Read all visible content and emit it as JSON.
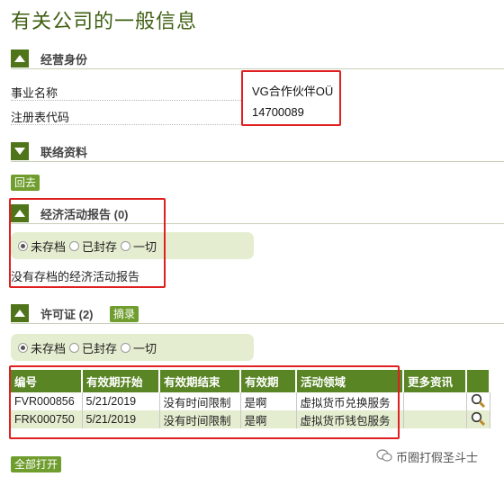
{
  "page_title": "有关公司的一般信息",
  "sections": {
    "business": {
      "title": "经营身份"
    },
    "contact": {
      "title": "联络资料"
    },
    "reports": {
      "title": "经济活动报告 (0)",
      "empty_note": "没有存档的经济活动报告"
    },
    "licenses": {
      "title": "许可证 (2)",
      "summary_button": "摘录"
    }
  },
  "fields": {
    "name_label": "事业名称",
    "name_value": "VG合作伙伴OÜ",
    "reg_label": "注册表代码",
    "reg_value": "14700089"
  },
  "back_button": "回去",
  "filters": {
    "unarchived": "未存档",
    "archived": "已封存",
    "all": "一切"
  },
  "table": {
    "headers": [
      "编号",
      "有效期开始",
      "有效期结束",
      "有效期",
      "活动领域",
      "更多资讯",
      ""
    ],
    "rows": [
      [
        "FVR000856",
        "5/21/2019",
        "没有时间限制",
        "是啊",
        "虚拟货币兑换服务",
        ""
      ],
      [
        "FRK000750",
        "5/21/2019",
        "没有时间限制",
        "是啊",
        "虚拟货币钱包服务",
        ""
      ]
    ]
  },
  "open_all_button": "全部打开",
  "watermark": "币圈打假圣斗士",
  "colors": {
    "accent": "#5a8525",
    "title": "#3e5f12",
    "highlight": "#e02020",
    "filter_bg": "#e4edcf"
  }
}
